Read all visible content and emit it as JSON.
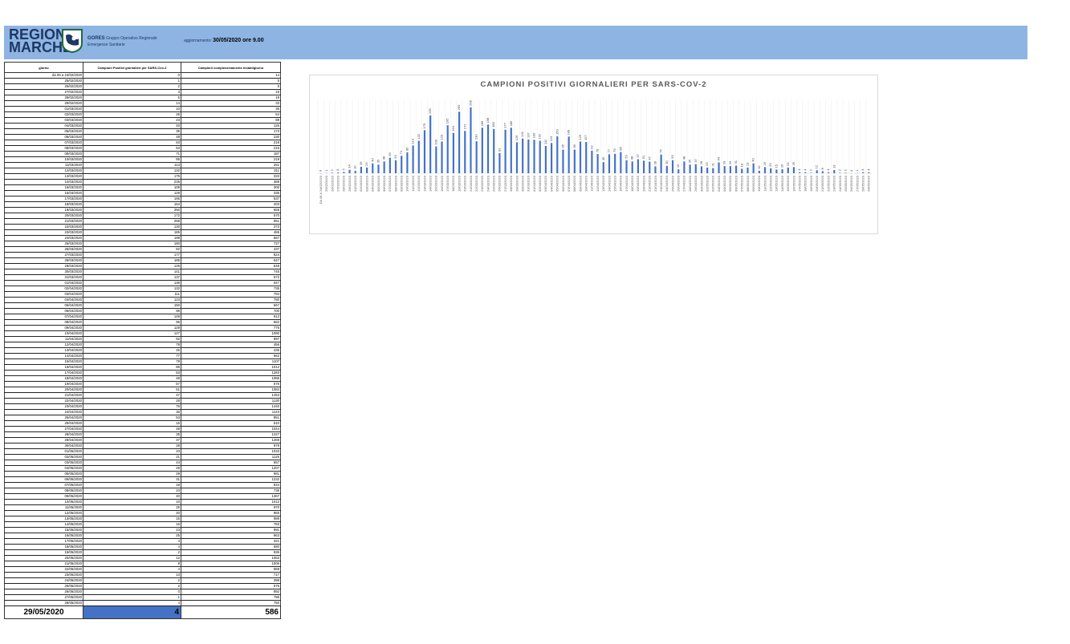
{
  "header": {
    "logo_line1": "REGIONE",
    "logo_line2": "MARCHE",
    "gores_bold": "GORES",
    "gores_text": "Gruppo Operativo Regionale",
    "gores_text2": "Emergenze Sanitarie",
    "update_label": "aggiornamento:",
    "update_value": "30/05/2020 ore 9.00"
  },
  "colors": {
    "header_bg": "#8eb4e3",
    "bar": "#4472c4",
    "highlight": "#4472c4"
  },
  "table": {
    "headers": [
      "giorno",
      "Campioni Positivi giornalieri per SARS-Cov-2",
      "Campioni complessivamente testati/giorno"
    ],
    "rows": [
      [
        "da 06 a 24/02/2020",
        "0",
        "14"
      ],
      [
        "25/02/2020",
        "1",
        "5"
      ],
      [
        "26/02/2020",
        "2",
        "8"
      ],
      [
        "27/02/2020",
        "3",
        "19"
      ],
      [
        "28/02/2020",
        "5",
        "19"
      ],
      [
        "29/02/2020",
        "14",
        "33"
      ],
      [
        "01/03/2020",
        "10",
        "36"
      ],
      [
        "02/03/2020",
        "26",
        "64"
      ],
      [
        "03/03/2020",
        "23",
        "89"
      ],
      [
        "04/03/2020",
        "40",
        "126"
      ],
      [
        "05/03/2020",
        "35",
        "173"
      ],
      [
        "06/03/2020",
        "48",
        "230"
      ],
      [
        "07/03/2020",
        "63",
        "218"
      ],
      [
        "08/03/2020",
        "53",
        "216"
      ],
      [
        "09/03/2020",
        "71",
        "187"
      ],
      [
        "10/03/2020",
        "85",
        "219"
      ],
      [
        "11/03/2020",
        "113",
        "251"
      ],
      [
        "12/03/2020",
        "132",
        "311"
      ],
      [
        "13/03/2020",
        "175",
        "333"
      ],
      [
        "14/03/2020",
        "235",
        "388"
      ],
      [
        "15/03/2020",
        "109",
        "300"
      ],
      [
        "16/03/2020",
        "129",
        "335"
      ],
      [
        "17/03/2020",
        "195",
        "537"
      ],
      [
        "18/03/2020",
        "164",
        "403"
      ],
      [
        "19/03/2020",
        "250",
        "658"
      ],
      [
        "20/03/2020",
        "172",
        "570"
      ],
      [
        "21/03/2020",
        "268",
        "651"
      ],
      [
        "22/03/2020",
        "130",
        "373"
      ],
      [
        "23/03/2020",
        "185",
        "465"
      ],
      [
        "24/03/2020",
        "198",
        "667"
      ],
      [
        "25/03/2020",
        "180",
        "727"
      ],
      [
        "26/03/2020",
        "82",
        "437"
      ],
      [
        "27/03/2020",
        "177",
        "824"
      ],
      [
        "28/03/2020",
        "185",
        "547"
      ],
      [
        "29/03/2020",
        "126",
        "548"
      ],
      [
        "30/03/2020",
        "141",
        "745"
      ],
      [
        "31/03/2020",
        "137",
        "572"
      ],
      [
        "01/04/2020",
        "136",
        "647"
      ],
      [
        "02/04/2020",
        "132",
        "735"
      ],
      [
        "03/04/2020",
        "111",
        "794"
      ],
      [
        "04/04/2020",
        "123",
        "780"
      ],
      [
        "05/04/2020",
        "150",
        "667"
      ],
      [
        "06/04/2020",
        "96",
        "700"
      ],
      [
        "07/04/2020",
        "149",
        "913"
      ],
      [
        "08/04/2020",
        "96",
        "662"
      ],
      [
        "09/04/2020",
        "129",
        "776"
      ],
      [
        "10/04/2020",
        "127",
        "1090"
      ],
      [
        "11/04/2020",
        "92",
        "997"
      ],
      [
        "12/04/2020",
        "78",
        "456"
      ],
      [
        "13/04/2020",
        "45",
        "436"
      ],
      [
        "14/04/2020",
        "77",
        "662"
      ],
      [
        "15/04/2020",
        "79",
        "1107"
      ],
      [
        "16/04/2020",
        "86",
        "1012"
      ],
      [
        "17/04/2020",
        "53",
        "1283"
      ],
      [
        "18/04/2020",
        "48",
        "1086"
      ],
      [
        "19/04/2020",
        "57",
        "676"
      ],
      [
        "20/04/2020",
        "51",
        "1084"
      ],
      [
        "21/04/2020",
        "47",
        "1453"
      ],
      [
        "22/04/2020",
        "28",
        "1130"
      ],
      [
        "23/04/2020",
        "76",
        "1440"
      ],
      [
        "24/04/2020",
        "30",
        "1143"
      ],
      [
        "25/04/2020",
        "53",
        "851"
      ],
      [
        "26/04/2020",
        "16",
        "510"
      ],
      [
        "27/04/2020",
        "48",
        "1044"
      ],
      [
        "28/04/2020",
        "35",
        "1227"
      ],
      [
        "29/04/2020",
        "37",
        "1268"
      ],
      [
        "30/04/2020",
        "28",
        "978"
      ],
      [
        "01/05/2020",
        "23",
        "1033"
      ],
      [
        "02/05/2020",
        "21",
        "1125"
      ],
      [
        "03/05/2020",
        "44",
        "557"
      ],
      [
        "04/05/2020",
        "29",
        "1207"
      ],
      [
        "05/05/2020",
        "29",
        "981"
      ],
      [
        "06/05/2020",
        "31",
        "1232"
      ],
      [
        "07/05/2020",
        "18",
        "834"
      ],
      [
        "08/05/2020",
        "23",
        "735"
      ],
      [
        "09/05/2020",
        "40",
        "1367"
      ],
      [
        "10/05/2020",
        "10",
        "1012"
      ],
      [
        "11/05/2020",
        "25",
        "970"
      ],
      [
        "12/05/2020",
        "20",
        "865"
      ],
      [
        "13/05/2020",
        "15",
        "989"
      ],
      [
        "14/05/2020",
        "16",
        "783"
      ],
      [
        "15/05/2020",
        "23",
        "891"
      ],
      [
        "16/05/2020",
        "25",
        "863"
      ],
      [
        "17/05/2020",
        "4",
        "321"
      ],
      [
        "18/05/2020",
        "4",
        "680"
      ],
      [
        "19/05/2020",
        "2",
        "936"
      ],
      [
        "20/05/2020",
        "12",
        "1063"
      ],
      [
        "21/05/2020",
        "8",
        "1006"
      ],
      [
        "22/05/2020",
        "4",
        "559"
      ],
      [
        "23/05/2020",
        "13",
        "717"
      ],
      [
        "24/05/2020",
        "2",
        "398"
      ],
      [
        "25/05/2020",
        "2",
        "576"
      ],
      [
        "26/05/2020",
        "0",
        "892"
      ],
      [
        "27/05/2020",
        "1",
        "796"
      ],
      [
        "28/05/2020",
        "4",
        "750"
      ]
    ],
    "total": {
      "date": "29/05/2020",
      "positivi": "4",
      "testati": "586"
    }
  },
  "chart_data": {
    "type": "bar",
    "title": "CAMPIONI POSITIVI GIORNALIERI PER SARS-COV-2",
    "categories": [
      "DA 06 A 24/02/2020",
      "25/02/2020",
      "26/02/2020",
      "27/02/2020",
      "28/02/2020",
      "29/02/2020",
      "01/03/2020",
      "02/03/2020",
      "03/03/2020",
      "04/03/2020",
      "05/03/2020",
      "06/03/2020",
      "07/03/2020",
      "08/03/2020",
      "09/03/2020",
      "10/03/2020",
      "11/03/2020",
      "12/03/2020",
      "13/03/2020",
      "14/03/2020",
      "15/03/2020",
      "16/03/2020",
      "17/03/2020",
      "18/03/2020",
      "19/03/2020",
      "20/03/2020",
      "21/03/2020",
      "22/03/2020",
      "23/03/2020",
      "24/03/2020",
      "25/03/2020",
      "26/03/2020",
      "27/03/2020",
      "28/03/2020",
      "29/03/2020",
      "30/03/2020",
      "31/03/2020",
      "01/04/2020",
      "02/04/2020",
      "03/04/2020",
      "04/04/2020",
      "05/04/2020",
      "06/04/2020",
      "07/04/2020",
      "08/04/2020",
      "09/04/2020",
      "10/04/2020",
      "11/04/2020",
      "12/04/2020",
      "13/04/2020",
      "14/04/2020",
      "15/04/2020",
      "16/04/2020",
      "17/04/2020",
      "18/04/2020",
      "19/04/2020",
      "20/04/2020",
      "21/04/2020",
      "22/04/2020",
      "23/04/2020",
      "24/04/2020",
      "25/04/2020",
      "26/04/2020",
      "27/04/2020",
      "28/04/2020",
      "29/04/2020",
      "30/04/2020",
      "01/05/2020",
      "02/05/2020",
      "03/05/2020",
      "04/05/2020",
      "05/05/2020",
      "06/05/2020",
      "07/05/2020",
      "08/05/2020",
      "09/05/2020",
      "10/05/2020",
      "11/05/2020",
      "12/05/2020",
      "13/05/2020",
      "14/05/2020",
      "15/05/2020",
      "16/05/2020",
      "17/05/2020",
      "18/05/2020",
      "19/05/2020",
      "20/05/2020",
      "21/05/2020",
      "22/05/2020",
      "23/05/2020",
      "24/05/2020",
      "25/05/2020",
      "26/05/2020",
      "27/05/2020",
      "28/05/2020",
      "29/05/2020"
    ],
    "values": [
      0,
      1,
      2,
      3,
      5,
      14,
      10,
      26,
      23,
      40,
      35,
      48,
      63,
      53,
      71,
      85,
      113,
      132,
      175,
      235,
      109,
      129,
      195,
      164,
      250,
      172,
      268,
      130,
      185,
      198,
      180,
      82,
      177,
      185,
      126,
      141,
      137,
      136,
      132,
      111,
      123,
      150,
      96,
      149,
      96,
      129,
      127,
      92,
      78,
      45,
      77,
      79,
      86,
      53,
      48,
      57,
      51,
      47,
      28,
      76,
      30,
      53,
      16,
      48,
      35,
      37,
      28,
      23,
      21,
      44,
      29,
      29,
      31,
      18,
      23,
      40,
      10,
      25,
      20,
      15,
      16,
      23,
      25,
      4,
      4,
      2,
      12,
      8,
      4,
      13,
      2,
      2,
      0,
      1,
      4,
      4
    ],
    "ylim": [
      0,
      300
    ],
    "grid": false,
    "legend": "none"
  }
}
